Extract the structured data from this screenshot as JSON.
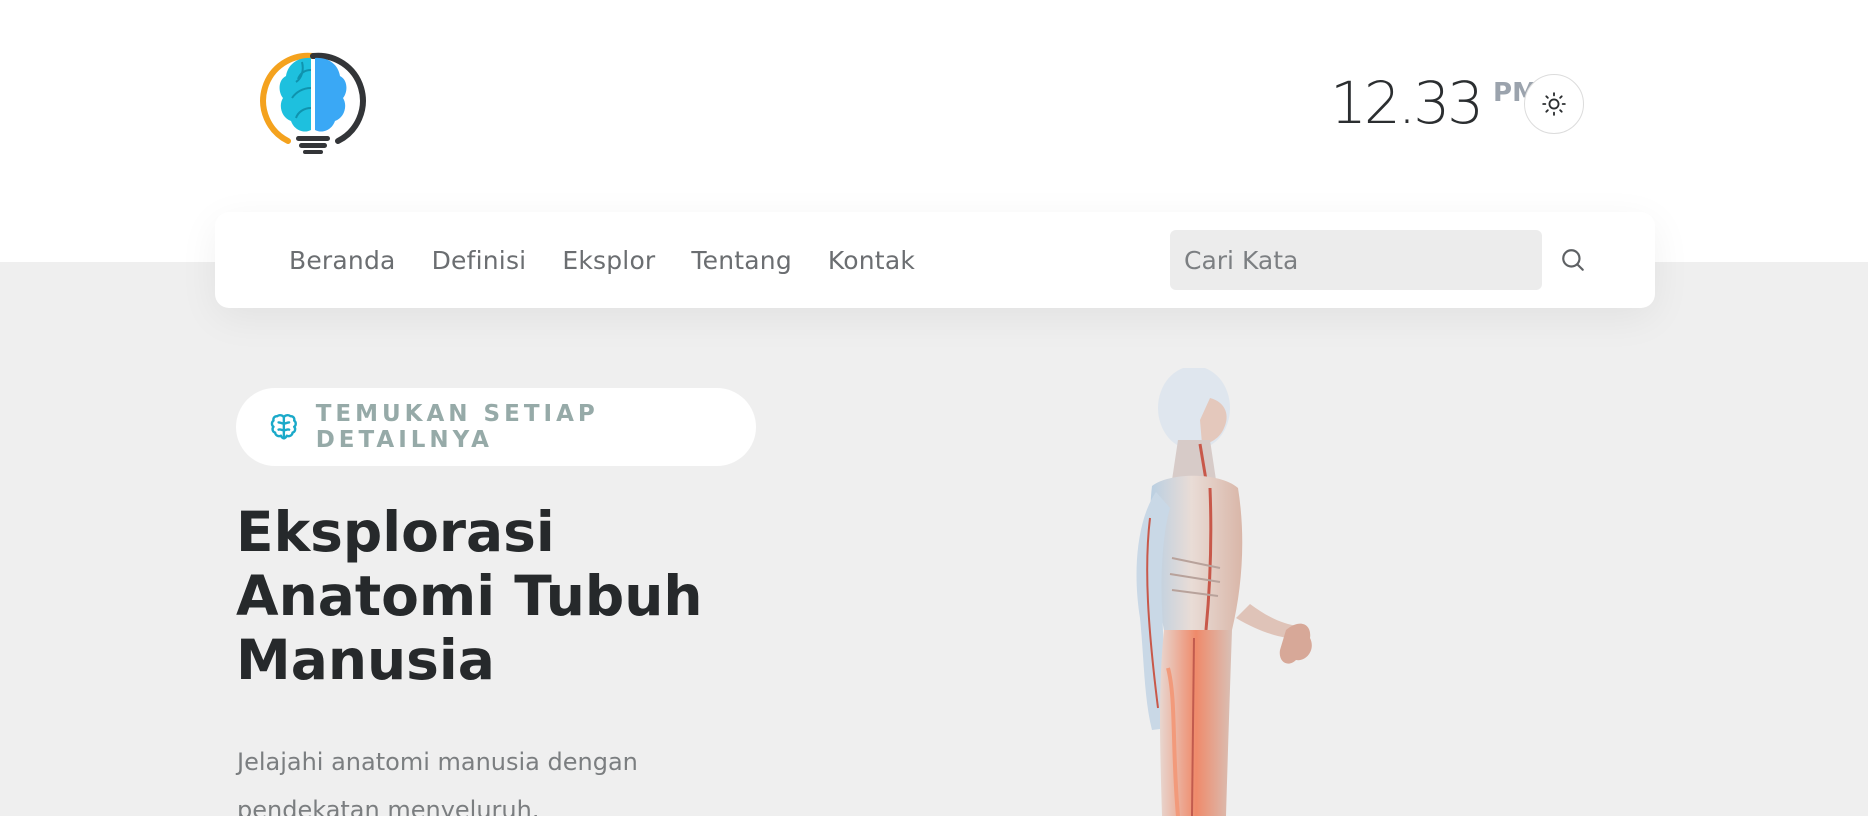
{
  "header": {
    "logo_name": "brain-bulb-logo",
    "clock": {
      "time": "12.33",
      "ampm": "PM"
    },
    "theme_toggle_icon": "sun-icon"
  },
  "nav": {
    "items": [
      {
        "label": "Beranda"
      },
      {
        "label": "Definisi"
      },
      {
        "label": "Eksplor"
      },
      {
        "label": "Tentang"
      },
      {
        "label": "Kontak"
      }
    ],
    "search": {
      "placeholder": "Cari Kata",
      "icon": "search-icon"
    }
  },
  "hero": {
    "badge": {
      "icon": "brain-icon",
      "text": "TEMUKAN SETIAP DETAILNYA"
    },
    "title_lines": [
      "Eksplorasi",
      "Anatomi Tubuh",
      "Manusia"
    ],
    "subtitle_lines": [
      "Jelajahi anatomi manusia dengan",
      "pendekatan menyeluruh."
    ],
    "image_name": "human-anatomy-figure"
  },
  "colors": {
    "brand_cyan": "#1aa9c9",
    "brand_blue": "#3aa8f5",
    "brand_orange": "#f4a21e",
    "badge_text": "#96aaa8",
    "page_bg": "#efefef"
  }
}
